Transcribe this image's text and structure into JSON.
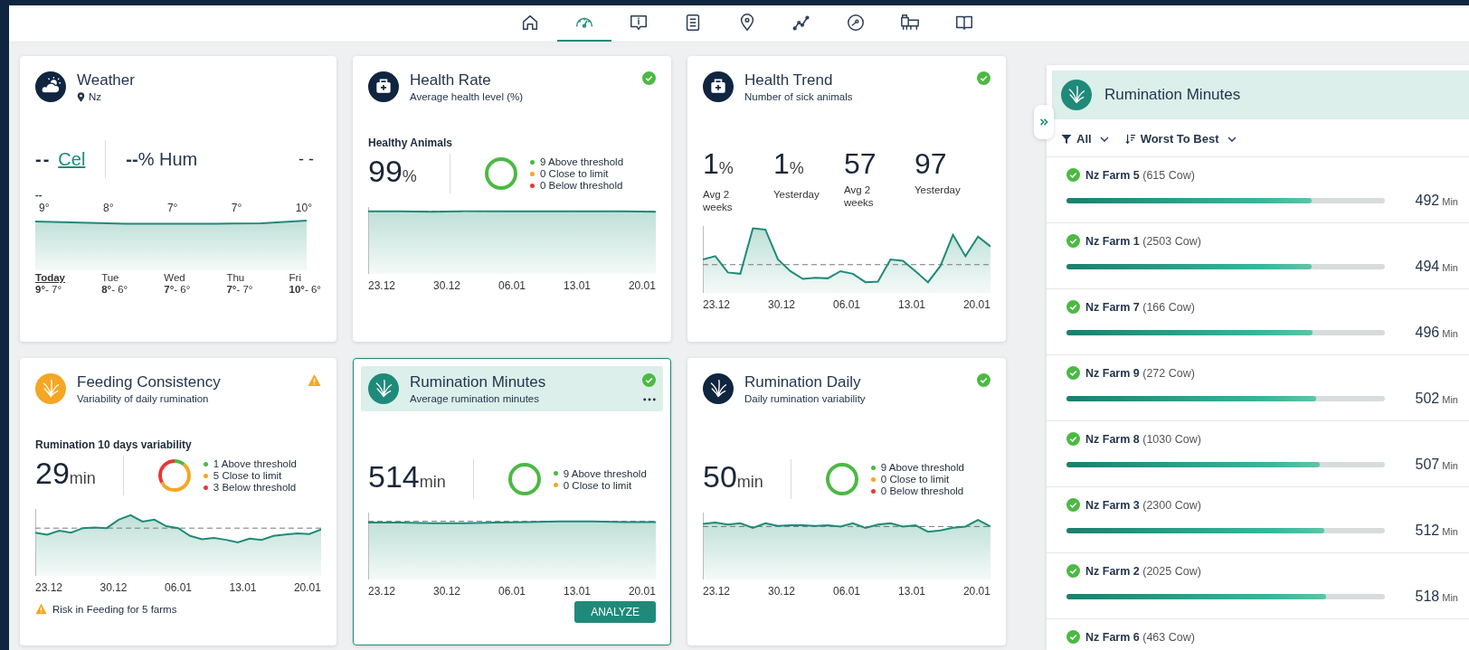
{
  "nav": [
    {
      "kind": "home",
      "selected": false
    },
    {
      "kind": "gauge",
      "selected": true
    },
    {
      "kind": "alert",
      "selected": false
    },
    {
      "kind": "report",
      "selected": false
    },
    {
      "kind": "location",
      "selected": false
    },
    {
      "kind": "trend",
      "selected": false
    },
    {
      "kind": "compass",
      "selected": false
    },
    {
      "kind": "animals",
      "selected": false
    },
    {
      "kind": "book",
      "selected": false
    }
  ],
  "cards": [
    {
      "kind": "weather",
      "title": "Weather",
      "location": "Nz",
      "color": "#0f2540",
      "selected": false,
      "temperature": "--",
      "unit": "Cel",
      "humidity": "**--**% Hum",
      "side_reading": "- -",
      "note": "--",
      "temps": [
        "9°",
        "8°",
        "7°",
        "7°",
        "10°"
      ],
      "days": [
        {
          "name": "Today",
          "high": "9°",
          "low": "- 7°",
          "selected": true
        },
        {
          "name": "Tue",
          "high": "8°",
          "low": "- 6°",
          "selected": false
        },
        {
          "name": "Wed",
          "high": "7°",
          "low": "- 6°",
          "selected": false
        },
        {
          "name": "Thu",
          "high": "7°",
          "low": "- 7°",
          "selected": false
        },
        {
          "name": "Fri",
          "high": "10°",
          "low": "- 6°",
          "selected": false
        }
      ]
    },
    {
      "kind": "metric",
      "title": "Health Rate",
      "subtitle": "Average health level (%)",
      "color": "#0f2540",
      "warning": false,
      "selected": false,
      "caption": "Healthy Animals",
      "value": "99",
      "unit": "%",
      "legend": [
        {
          "text": "9 Above threshold",
          "color": "#4cb944"
        },
        {
          "text": "0 Close to limit",
          "color": "#f5a623"
        },
        {
          "text": "0 Below threshold",
          "color": "#e53935"
        }
      ],
      "x_labels": [
        "23.12",
        "30.12",
        "06.01",
        "13.01",
        "20.01"
      ]
    },
    {
      "kind": "trend",
      "title": "Health Trend",
      "subtitle": "Number of sick animals",
      "color": "#0f2540",
      "warning": false,
      "selected": false,
      "stats": [
        {
          "value": "1",
          "unit": "%",
          "label": "Avg 2 weeks"
        },
        {
          "value": "1",
          "unit": "%",
          "label": "Yesterday"
        },
        {
          "value": "57",
          "label": "Avg 2 weeks"
        },
        {
          "value": "97",
          "label": "Yesterday"
        }
      ],
      "x_labels": [
        "23.12",
        "30.12",
        "06.01",
        "13.01",
        "20.01"
      ]
    },
    {
      "kind": "metric",
      "title": "Feeding Consistency",
      "subtitle": "Variability of daily rumination",
      "color": "#f5a623",
      "warning": true,
      "selected": false,
      "caption": "Rumination 10 days variability",
      "value": "29",
      "unit": "min",
      "legend": [
        {
          "text": "1 Above threshold",
          "color": "#4cb944"
        },
        {
          "text": "5 Close to limit",
          "color": "#f5a623"
        },
        {
          "text": "3 Below threshold",
          "color": "#e53935"
        }
      ],
      "x_labels": [
        "23.12",
        "30.12",
        "06.01",
        "13.01",
        "20.01"
      ],
      "footer": "Risk in Feeding for 5 farms"
    },
    {
      "kind": "metric",
      "title": "Rumination Minutes",
      "subtitle": "Average rumination minutes",
      "color": "#1f8a7a",
      "warning": false,
      "selected": true,
      "value": "514",
      "unit": "min",
      "legend": [
        {
          "text": "9 Above threshold",
          "color": "#4cb944"
        },
        {
          "text": "0 Close to limit",
          "color": "#f5a623"
        }
      ],
      "x_labels": [
        "23.12",
        "30.12",
        "06.01",
        "13.01",
        "20.01"
      ],
      "action": "ANALYZE"
    },
    {
      "kind": "metric",
      "title": "Rumination Daily",
      "subtitle": "Daily rumination variability",
      "color": "#0f2540",
      "warning": false,
      "selected": false,
      "value": "50",
      "unit": "min",
      "legend": [
        {
          "text": "9 Above threshold",
          "color": "#4cb944"
        },
        {
          "text": "0 Close to limit",
          "color": "#f5a623"
        },
        {
          "text": "0 Below threshold",
          "color": "#e53935"
        }
      ],
      "x_labels": [
        "23.12",
        "30.12",
        "06.01",
        "13.01",
        "20.01"
      ]
    }
  ],
  "panel": {
    "title": "Rumination Minutes",
    "filter": "All",
    "sort": "Worst To Best",
    "farms": [
      {
        "name": "Nz Farm 5",
        "count": "(615 Cow)",
        "warning": false,
        "level": 0.77,
        "value": "492",
        "unit": "Min"
      },
      {
        "name": "Nz Farm 1",
        "count": "(2503 Cow)",
        "warning": false,
        "level": 0.77,
        "value": "494",
        "unit": "Min"
      },
      {
        "name": "Nz Farm 7",
        "count": "(166 Cow)",
        "warning": false,
        "level": 0.773,
        "value": "496",
        "unit": "Min"
      },
      {
        "name": "Nz Farm 9",
        "count": "(272 Cow)",
        "warning": false,
        "level": 0.785,
        "value": "502",
        "unit": "Min"
      },
      {
        "name": "Nz Farm 8",
        "count": "(1030 Cow)",
        "warning": false,
        "level": 0.795,
        "value": "507",
        "unit": "Min"
      },
      {
        "name": "Nz Farm 3",
        "count": "(2300 Cow)",
        "warning": false,
        "level": 0.81,
        "value": "512",
        "unit": "Min"
      },
      {
        "name": "Nz Farm 2",
        "count": "(2025 Cow)",
        "warning": false,
        "level": 0.816,
        "value": "518",
        "unit": "Min"
      },
      {
        "name": "Nz Farm 6",
        "count": "(463 Cow)",
        "warning": false
      }
    ]
  }
}
